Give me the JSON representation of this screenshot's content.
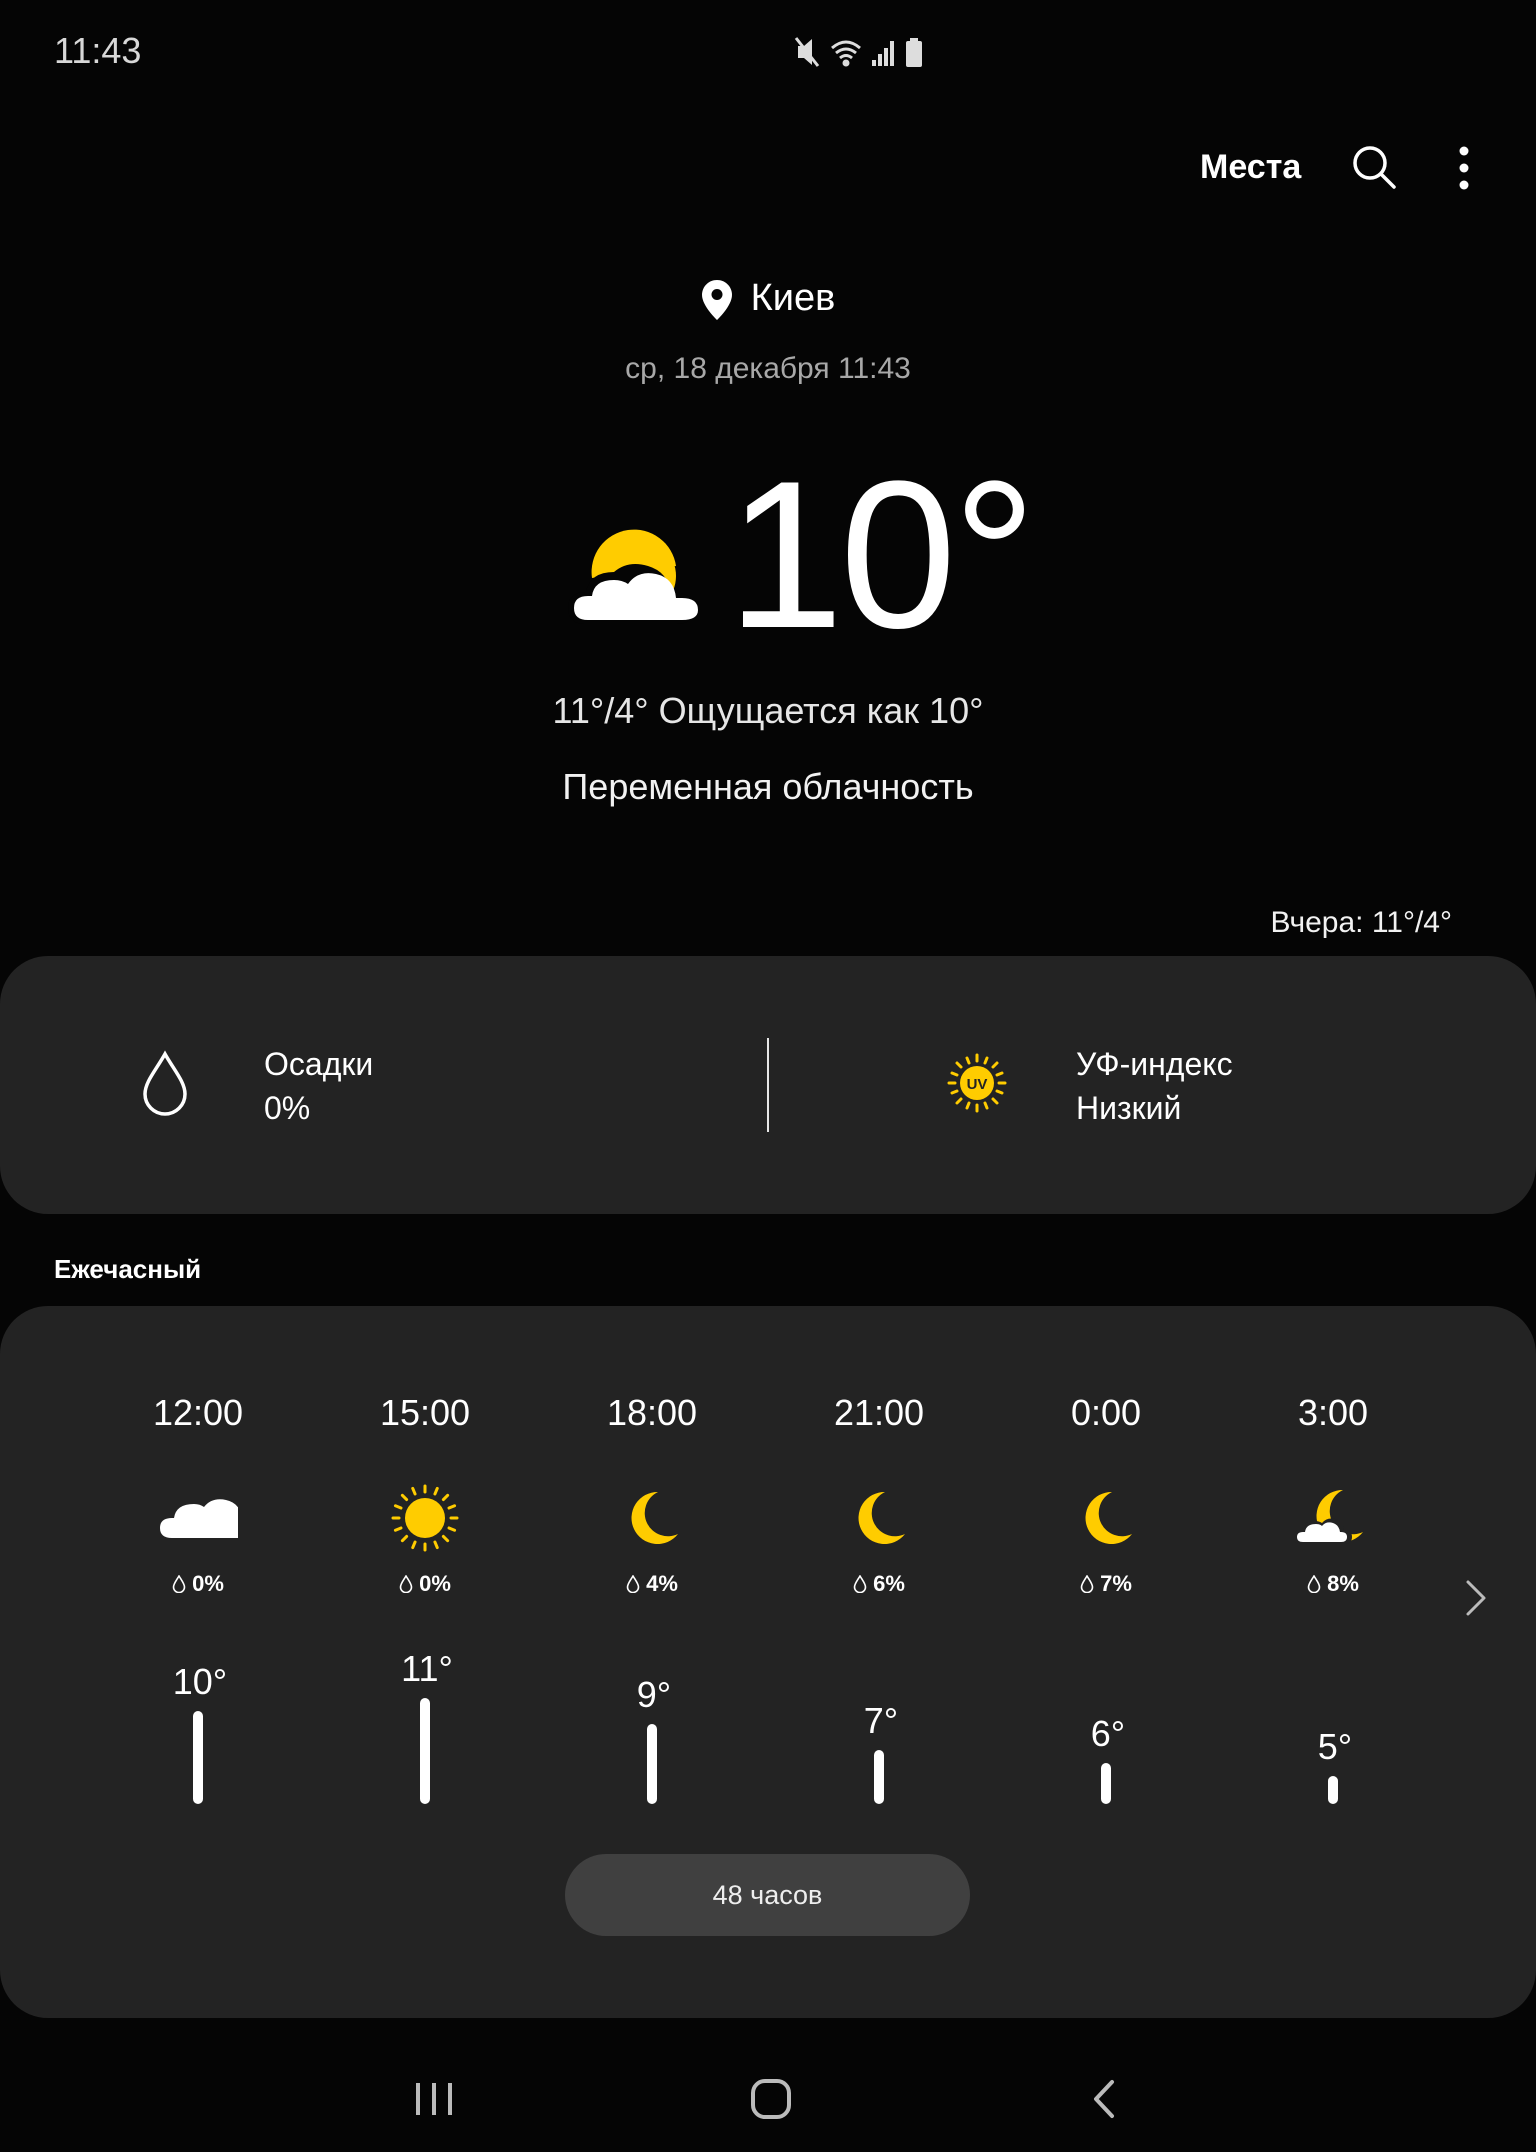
{
  "status_bar": {
    "time": "11:43",
    "icons": [
      "mute-icon",
      "wifi-icon",
      "signal-icon",
      "battery-icon"
    ]
  },
  "header": {
    "places_label": "Места",
    "search_icon": "search-icon",
    "more_icon": "more-vert-icon"
  },
  "location": {
    "city": "Киев",
    "datetime": "ср, 18 декабря 11:43"
  },
  "current": {
    "temp": "10°",
    "icon": "partly-cloudy-icon",
    "range_feels": "11°/4° Ощущается как 10°",
    "condition": "Переменная облачность",
    "yesterday": "Вчера: 11°/4°"
  },
  "details": {
    "precip_label": "Осадки",
    "precip_value": "0%",
    "uv_label": "УФ-индекс",
    "uv_value": "Низкий",
    "uv_badge": "UV"
  },
  "hourly": {
    "title": "Ежечасный",
    "items": [
      {
        "time": "12:00",
        "icon": "cloud-icon",
        "pop": "0%",
        "temp": "10°",
        "temp_value": 10
      },
      {
        "time": "15:00",
        "icon": "sun-icon",
        "pop": "0%",
        "temp": "11°",
        "temp_value": 11
      },
      {
        "time": "18:00",
        "icon": "moon-icon",
        "pop": "4%",
        "temp": "9°",
        "temp_value": 9
      },
      {
        "time": "21:00",
        "icon": "moon-icon",
        "pop": "6%",
        "temp": "7°",
        "temp_value": 7
      },
      {
        "time": "0:00",
        "icon": "moon-icon",
        "pop": "7%",
        "temp": "6°",
        "temp_value": 6
      },
      {
        "time": "3:00",
        "icon": "moon-cloud-icon",
        "pop": "8%",
        "temp": "5°",
        "temp_value": 5
      }
    ],
    "button_48h": "48 часов"
  },
  "colors": {
    "accent_yellow": "#ffcc00",
    "card_bg": "#232323",
    "bg": "#050505"
  }
}
